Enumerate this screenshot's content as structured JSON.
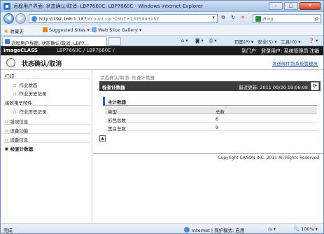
{
  "window": {
    "title": "远程用户界面: 状态确认/取消: LBP7660C: LBP7660C - Windows Internet Explorer",
    "min": "–",
    "max": "□",
    "close": "✕"
  },
  "addressbar": {
    "back": "◀",
    "forward": "▶",
    "url_host": "http://192.168.1.187",
    "url_path": "/dcount.cgi?CSUT=1375843157",
    "dropdown": "▾",
    "compat": "⧉",
    "reload": "↻",
    "stop": "✕",
    "search_placeholder": "Bing",
    "search_btn": "ρ"
  },
  "favorites": {
    "label": "收藏夹",
    "items": [
      "Suggested Sites ▾",
      "Web Slice Gallery ▾"
    ]
  },
  "tabs": {
    "active_tab": "远程用户界面: 状态确认/取消: LBP7...",
    "commands": [
      "页面(P) ▾",
      "安全(S) ▾",
      "工具(O) ▾",
      "❓ ▾"
    ]
  },
  "app": {
    "brand": "imageCLASS",
    "model": "LBP7660C / LBP7660C /",
    "top_link": "到门户",
    "user_info": "登录用户: 系统管理员",
    "logout": "注销",
    "page_title": "状态确认/取消",
    "email_admin": "发送邮件到系统管理员"
  },
  "sidebar": {
    "items": [
      {
        "label": "打印",
        "kind": "header"
      },
      {
        "label": "作业状态",
        "kind": "sub"
      },
      {
        "label": "作业历史记录",
        "kind": "sub"
      },
      {
        "label": "接收电子邮件",
        "kind": "header"
      },
      {
        "label": "作业历史记录",
        "kind": "sub"
      },
      {
        "label": "错误信息",
        "kind": "grp"
      },
      {
        "label": "设备功能",
        "kind": "grp"
      },
      {
        "label": "设备信息",
        "kind": "grp"
      },
      {
        "label": "检查计数器",
        "kind": "active"
      }
    ]
  },
  "main": {
    "breadcrumb": "状态确认/取消: 检查计数器",
    "panel_title": "检查计数器",
    "last_updated": "最近更新: 2011 09/20 19:06:08",
    "refresh_icon": "⟳",
    "section_title": "主计数器",
    "table": {
      "headers": [
        "类型",
        "总数"
      ],
      "rows": [
        [
          "彩色总数",
          "6"
        ],
        [
          "黑白总数",
          "9"
        ]
      ]
    },
    "to_top": "▲",
    "copyright": "Copyright CANON INC. 2011 All Rights Reserved"
  },
  "statusbar": {
    "left": "完成",
    "zone": "Internet | 保护模式: 启用",
    "misc": "◷ ▾",
    "zoom": "🔍 100% ▾"
  }
}
